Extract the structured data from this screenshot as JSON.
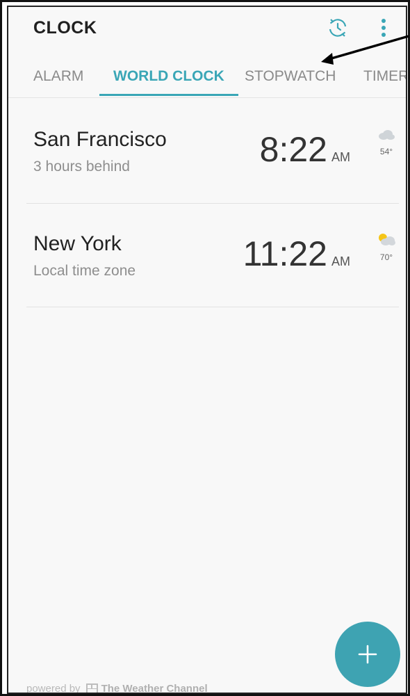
{
  "app": {
    "title": "CLOCK"
  },
  "toolbar": {
    "sync_icon": "sync-clock-icon",
    "menu_icon": "more-vert-icon"
  },
  "tabs": [
    {
      "label": "ALARM",
      "active": false
    },
    {
      "label": "WORLD CLOCK",
      "active": true
    },
    {
      "label": "STOPWATCH",
      "active": false
    },
    {
      "label": "TIMER",
      "active": false
    }
  ],
  "cities": [
    {
      "name": "San Francisco",
      "offset": "3 hours behind",
      "time": "8:22",
      "ampm": "AM",
      "temperature": "54°",
      "weather_icon": "cloudy-icon"
    },
    {
      "name": "New York",
      "offset": "Local time zone",
      "time": "11:22",
      "ampm": "AM",
      "temperature": "70°",
      "weather_icon": "partly-sunny-icon"
    }
  ],
  "fab": {
    "icon": "plus-icon"
  },
  "footer": {
    "prefix": "powered by",
    "brand": "The Weather Channel"
  },
  "colors": {
    "accent": "#3aa6b6",
    "fab": "#3ea3b2",
    "background": "#f8f8f8"
  }
}
